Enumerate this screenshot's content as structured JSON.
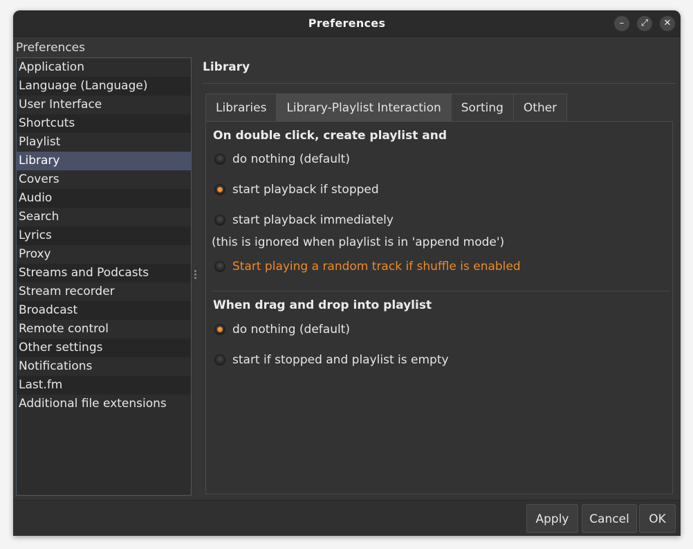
{
  "window": {
    "title": "Preferences",
    "minimize_icon": "minimize-icon",
    "maximize_icon": "maximize-icon",
    "close_icon": "close-icon",
    "minimize_glyph": "–",
    "maximize_glyph": "⤢",
    "close_glyph": "✕"
  },
  "sidebar": {
    "heading": "Preferences",
    "items": [
      {
        "label": "Application"
      },
      {
        "label": "Language (Language)"
      },
      {
        "label": "User Interface"
      },
      {
        "label": "Shortcuts"
      },
      {
        "label": "Playlist"
      },
      {
        "label": "Library",
        "selected": true
      },
      {
        "label": "Covers"
      },
      {
        "label": "Audio"
      },
      {
        "label": "Search"
      },
      {
        "label": "Lyrics"
      },
      {
        "label": "Proxy"
      },
      {
        "label": "Streams and Podcasts"
      },
      {
        "label": "Stream recorder"
      },
      {
        "label": "Broadcast"
      },
      {
        "label": "Remote control"
      },
      {
        "label": "Other settings"
      },
      {
        "label": "Notifications"
      },
      {
        "label": "Last.fm"
      },
      {
        "label": "Additional file extensions"
      }
    ]
  },
  "main": {
    "title": "Library",
    "tabs": [
      {
        "label": "Libraries"
      },
      {
        "label": "Library-Playlist Interaction",
        "active": true
      },
      {
        "label": "Sorting"
      },
      {
        "label": "Other"
      }
    ],
    "double_click": {
      "title": "On double click, create playlist and",
      "options": [
        {
          "label": "do nothing (default)",
          "checked": false
        },
        {
          "label": "start playback if stopped",
          "checked": true
        },
        {
          "label": "start playback immediately",
          "checked": false
        }
      ],
      "note": "(this is ignored when playlist is in 'append mode')",
      "shuffle_option": {
        "label": "Start playing a random track if shuffle is enabled",
        "checked": false
      }
    },
    "drag_drop": {
      "title": "When drag and drop into playlist",
      "options": [
        {
          "label": "do nothing (default)",
          "checked": true
        },
        {
          "label": "start if stopped and playlist is empty",
          "checked": false
        }
      ]
    }
  },
  "footer": {
    "apply_label": "Apply",
    "cancel_label": "Cancel",
    "ok_label": "OK"
  },
  "colors": {
    "accent": "#f08a24",
    "selection": "#4a5067",
    "background": "#353535"
  }
}
